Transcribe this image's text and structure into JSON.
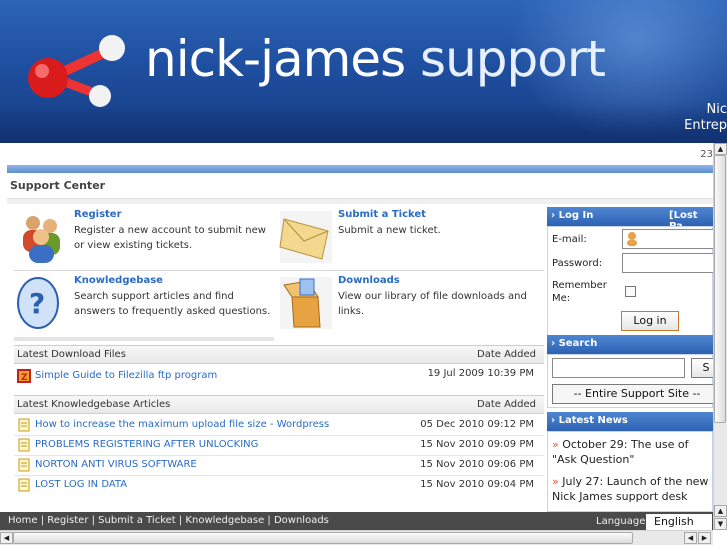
{
  "header": {
    "brand_main": "nick-james",
    "brand_sub": " support",
    "tag_line1": "Nic",
    "tag_line2": "Entrep",
    "counter": "23"
  },
  "section_title": "Support Center",
  "tiles": [
    {
      "title": "Register",
      "desc": "Register a new account to submit new or view existing tickets.",
      "icon": "users-icon"
    },
    {
      "title": "Submit a Ticket",
      "desc": "Submit a new ticket.",
      "icon": "envelope-icon"
    },
    {
      "title": "Knowledgebase",
      "desc": "Search support articles and find answers to frequently asked questions.",
      "icon": "question-icon"
    },
    {
      "title": "Downloads",
      "desc": "View our library of file downloads and links.",
      "icon": "box-icon"
    }
  ],
  "downloads": {
    "header_left": "Latest Download Files",
    "header_right": "Date Added",
    "rows": [
      {
        "title": "Simple Guide to Filezilla ftp program",
        "date": "19 Jul 2009 10:39 PM"
      }
    ]
  },
  "kb": {
    "header_left": "Latest Knowledgebase Articles",
    "header_right": "Date Added",
    "rows": [
      {
        "title": "How to increase the maximum upload file size - Wordpress",
        "date": "05 Dec 2010 09:12 PM"
      },
      {
        "title": "PROBLEMS REGISTERING AFTER UNLOCKING",
        "date": "15 Nov 2010 09:09 PM"
      },
      {
        "title": "NORTON ANTI VIRUS SOFTWARE",
        "date": "15 Nov 2010 09:06 PM"
      },
      {
        "title": "LOST LOG IN DATA",
        "date": "15 Nov 2010 09:04 PM"
      }
    ]
  },
  "login": {
    "title": "Log In",
    "lost_password": "[Lost Pa",
    "email_label": "E-mail:",
    "password_label": "Password:",
    "remember_label": "Remember Me:",
    "button": "Log in"
  },
  "search": {
    "title": "Search",
    "button": "S",
    "scope": "-- Entire Support Site --"
  },
  "news": {
    "title": "Latest News",
    "items": [
      {
        "text": "October 29: The use of \"Ask Question\""
      },
      {
        "text": "July 27: Launch of the new Nick James support desk"
      }
    ]
  },
  "footer": {
    "links": "Home | Register | Submit a Ticket | Knowledgebase | Downloads",
    "language_label": "Language:",
    "language_value": "English"
  },
  "colors": {
    "link": "#2a6bc4",
    "header_blue": "#1f4fa0",
    "sidebar_head": "#2d62b3",
    "bullet": "#e0502a"
  }
}
